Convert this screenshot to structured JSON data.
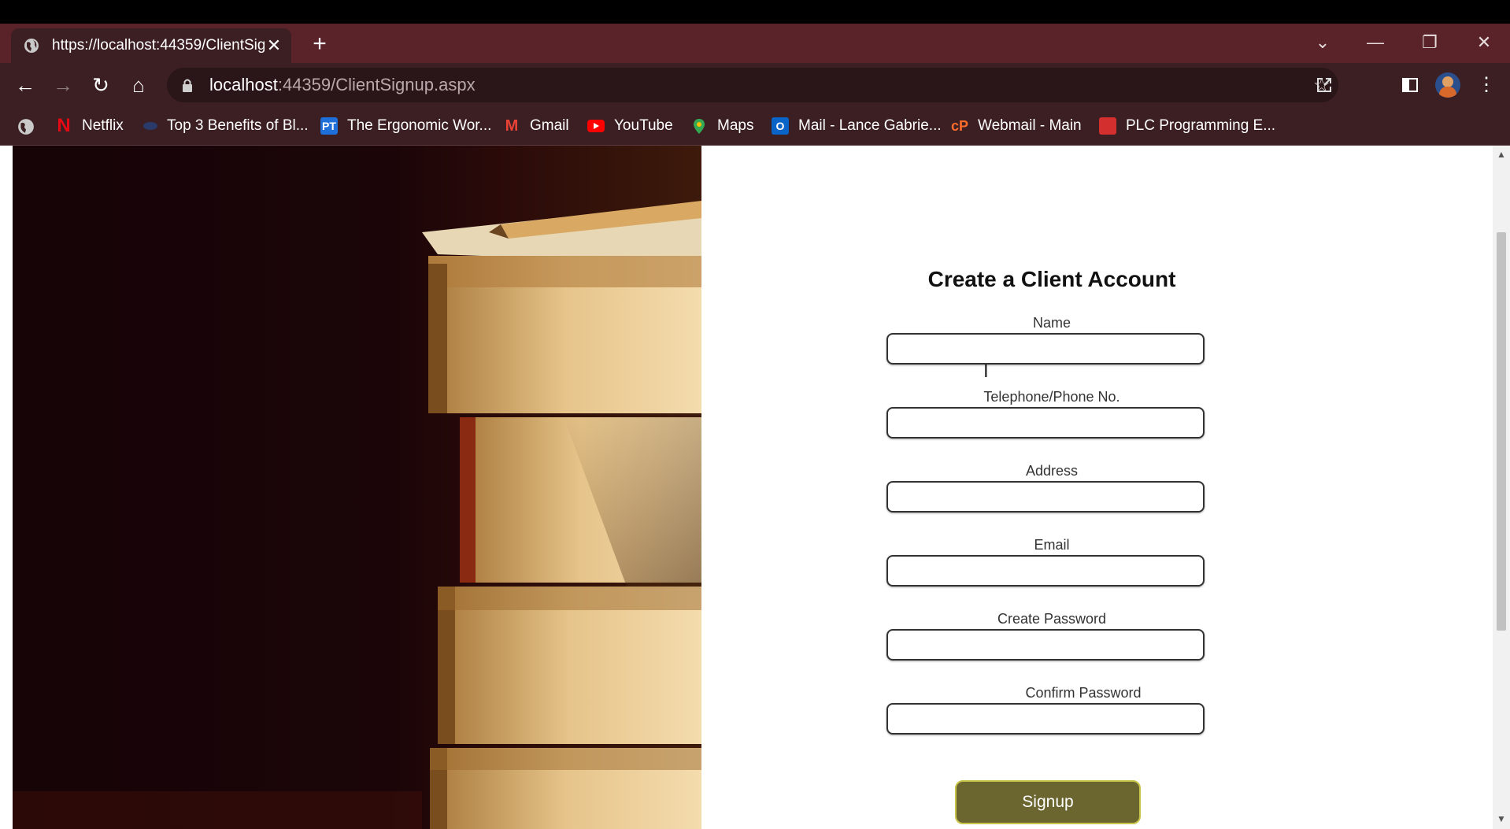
{
  "browser": {
    "tab_title": "https://localhost:44359/ClientSig",
    "url_host": "localhost",
    "url_rest": ":44359/ClientSignup.aspx",
    "bookmarks": [
      {
        "label": "Netflix",
        "icon": "netflix-icon",
        "color": "#e50914"
      },
      {
        "label": "Top 3 Benefits of Bl...",
        "icon": "site-icon",
        "color": "#2a5aa8"
      },
      {
        "label": "The Ergonomic Wor...",
        "icon": "pt-icon",
        "color": "#1e6fd9"
      },
      {
        "label": "Gmail",
        "icon": "gmail-icon",
        "color": "#ea4335"
      },
      {
        "label": "YouTube",
        "icon": "youtube-icon",
        "color": "#ff0000"
      },
      {
        "label": "Maps",
        "icon": "maps-icon",
        "color": "#34a853"
      },
      {
        "label": "Mail - Lance Gabrie...",
        "icon": "outlook-icon",
        "color": "#0a64c8"
      },
      {
        "label": "Webmail - Main",
        "icon": "cpanel-icon",
        "color": "#ff6c2c"
      },
      {
        "label": "PLC Programming E...",
        "icon": "plc-icon",
        "color": "#d32f2f"
      }
    ]
  },
  "form": {
    "title": "Create a Client Account",
    "fields": [
      {
        "label": "Name",
        "value": ""
      },
      {
        "label": "Telephone/Phone No.",
        "value": ""
      },
      {
        "label": "Address",
        "value": ""
      },
      {
        "label": "Email",
        "value": ""
      },
      {
        "label": "Create Password",
        "value": ""
      },
      {
        "label": "Confirm Password",
        "value": ""
      }
    ],
    "submit_label": "Signup"
  },
  "colors": {
    "tab_strip": "#5a2229",
    "toolbar": "#3b1f23",
    "button": "#6b6530",
    "button_border": "#c9c54a"
  }
}
